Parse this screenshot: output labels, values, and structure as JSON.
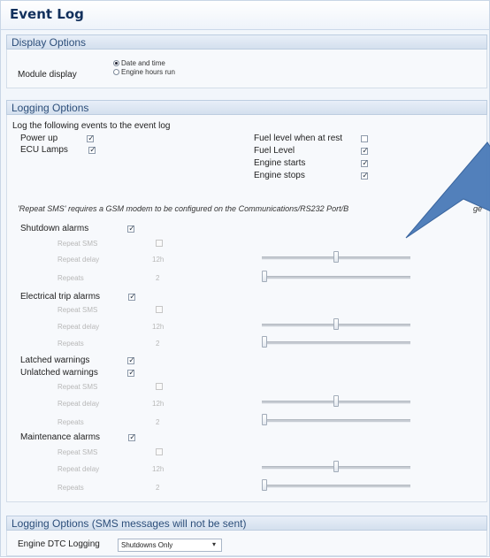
{
  "window": {
    "title": "Event Log"
  },
  "display_options": {
    "header": "Display Options",
    "module_display_label": "Module display",
    "radio_options": [
      {
        "label": "Date and time",
        "selected": true
      },
      {
        "label": "Engine hours run",
        "selected": false
      }
    ]
  },
  "logging_options": {
    "header": "Logging Options",
    "intro": "Log the following events to the event log",
    "left_events": [
      {
        "label": "Power up",
        "checked": true
      },
      {
        "label": "ECU Lamps",
        "checked": true
      }
    ],
    "right_events": [
      {
        "label": "Fuel level when at rest",
        "checked": false
      },
      {
        "label": "Fuel Level",
        "checked": true
      },
      {
        "label": "Engine starts",
        "checked": true
      },
      {
        "label": "Engine stops",
        "checked": true
      }
    ],
    "sms_note": "'Repeat SMS' requires a GSM modem to be configured on the Communications/RS232 Port/B",
    "sms_note_tail": "ge",
    "alarm_groups": [
      {
        "label": "Shutdown alarms",
        "checked": true,
        "repeat_sms": "Repeat SMS",
        "repeat_delay": "Repeat delay",
        "delay_value": "12h",
        "repeats": "Repeats",
        "repeats_value": "2"
      },
      {
        "label": "Electrical trip alarms",
        "checked": true,
        "repeat_sms": "Repeat SMS",
        "repeat_delay": "Repeat delay",
        "delay_value": "12h",
        "repeats": "Repeats",
        "repeats_value": "2"
      },
      {
        "label": "Latched warnings",
        "checked": true
      },
      {
        "label": "Unlatched warnings",
        "checked": true,
        "repeat_sms": "Repeat SMS",
        "repeat_delay": "Repeat delay",
        "delay_value": "12h",
        "repeats": "Repeats",
        "repeats_value": "2"
      },
      {
        "label": "Maintenance alarms",
        "checked": true,
        "repeat_sms": "Repeat SMS",
        "repeat_delay": "Repeat delay",
        "delay_value": "12h",
        "repeats": "Repeats",
        "repeats_value": "2"
      }
    ],
    "delay_slider_level": 0.48,
    "repeats_slider_level": 0.0
  },
  "sms_logging": {
    "header": "Logging Options (SMS messages will not be sent)",
    "dtc_label": "Engine DTC Logging",
    "dtc_value": "Shutdowns Only"
  },
  "colors": {
    "accent": "#12305c",
    "callout": "#4a7ab8",
    "section": "#2c4e7a"
  }
}
